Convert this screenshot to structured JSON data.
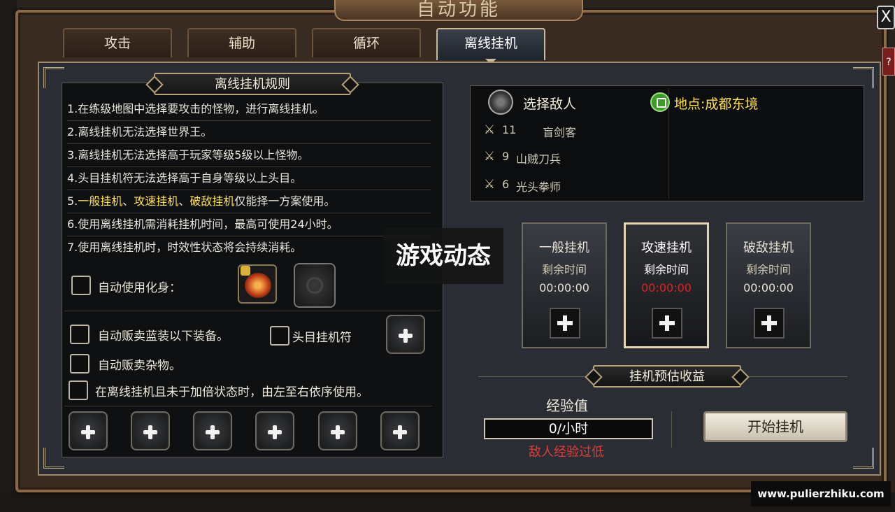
{
  "window": {
    "title": "自动功能",
    "close_label": "X",
    "help_label": "?"
  },
  "tabs": [
    {
      "label": "攻击",
      "active": false
    },
    {
      "label": "辅助",
      "active": false
    },
    {
      "label": "循环",
      "active": false
    },
    {
      "label": "离线挂机",
      "active": true
    }
  ],
  "rules": {
    "title": "离线挂机规则",
    "items": [
      "1.在练级地图中选择要攻击的怪物，进行离线挂机。",
      "2.离线挂机无法选择世界王。",
      "3.离线挂机无法选择高于玩家等级5级以上怪物。",
      "4.头目挂机符无法选择高于自身等级以上头目。",
      "5.{一般挂机}、{攻速挂机}、{破敌挂机}仅能择一方案使用。",
      "6.使用离线挂机需消耗挂机时间，最高可使用24小时。",
      "7.使用离线挂机时，时效性状态将会持续消耗。"
    ],
    "rule5": {
      "prefix": "5.",
      "hl1": "一般挂机",
      "sep1": "、",
      "hl2": "攻速挂机",
      "sep2": "、",
      "hl3": "破敌挂机",
      "suffix": "仅能择一方案使用。"
    }
  },
  "options": {
    "auto_avatar": "自动使用化身：",
    "sell_blue": "自动贩卖蓝装以下装备。",
    "boss_charm": "头目挂机符",
    "sell_misc": "自动贩卖杂物。",
    "boost_order": "在离线挂机且未于加倍状态时，由左至右依序使用。"
  },
  "enemies": {
    "select_label": "选择敌人",
    "location_label": "地点:成都东境",
    "list": [
      {
        "level": "11",
        "name": "盲剑客"
      },
      {
        "level": "9",
        "name": "山贼刀兵"
      },
      {
        "level": "6",
        "name": "光头拳师"
      }
    ]
  },
  "modes": [
    {
      "name": "一般挂机",
      "sub": "剩余时间",
      "time": "00:00:00",
      "active": false
    },
    {
      "name": "攻速挂机",
      "sub": "剩余时间",
      "time": "00:00:00",
      "active": true
    },
    {
      "name": "破敌挂机",
      "sub": "剩余时间",
      "time": "00:00:00",
      "active": false
    }
  ],
  "income": {
    "title": "挂机预估收益",
    "exp_label": "经验值",
    "exp_value": "0/小时",
    "warning": "敌人经验过低",
    "start_button": "开始挂机"
  },
  "overlay": {
    "watermark": "游戏动态",
    "site": "www.pulierzhiku.com"
  },
  "colors": {
    "highlight": "#ffe14a",
    "warning": "#e23b3b",
    "active_time": "#e02222"
  }
}
